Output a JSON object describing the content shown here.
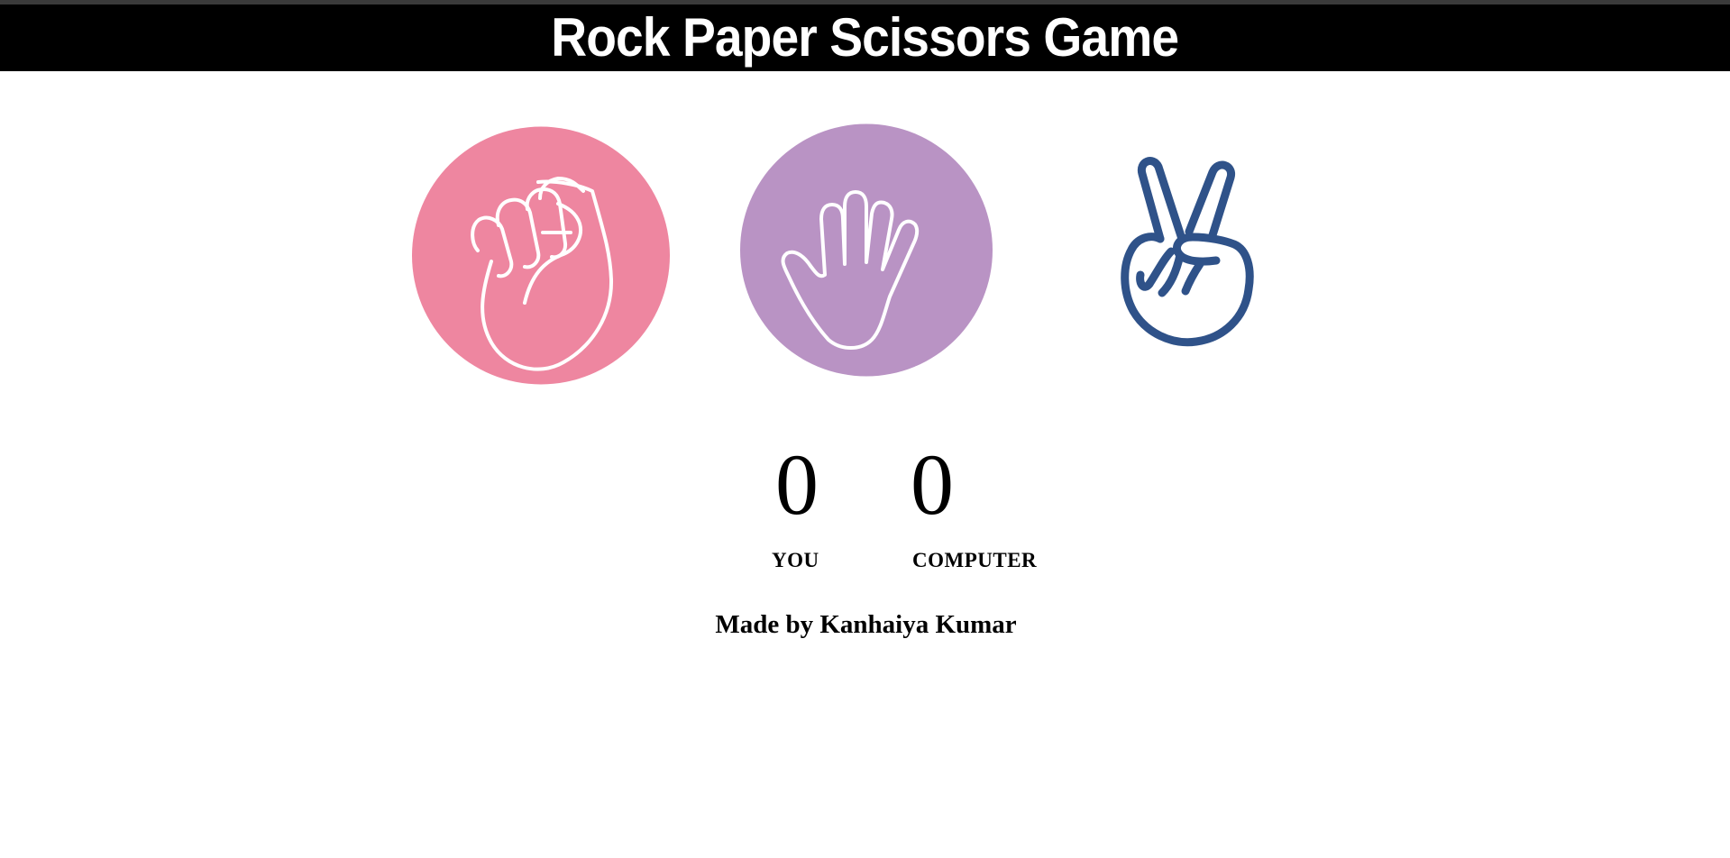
{
  "header": {
    "title": "Rock Paper Scissors Game"
  },
  "choices": [
    {
      "id": "rock",
      "icon": "fist-icon",
      "color": "#ee86a0"
    },
    {
      "id": "paper",
      "icon": "open-hand-icon",
      "color": "#b993c4"
    },
    {
      "id": "scissors",
      "icon": "victory-hand-icon",
      "color": "#2f5289"
    }
  ],
  "scoreboard": {
    "user_score": "0",
    "computer_score": "0",
    "user_label": "YOU",
    "computer_label": "COMPUTER"
  },
  "footer": {
    "credit": "Made by Kanhaiya Kumar"
  }
}
